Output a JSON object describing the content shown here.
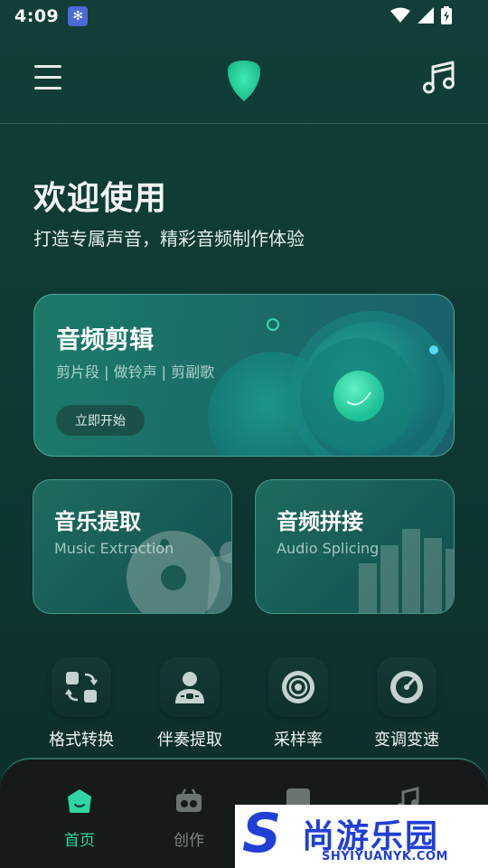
{
  "status_bar": {
    "time": "4:09"
  },
  "header": {
    "menu_icon": "hamburger-menu-icon",
    "logo_icon": "guitar-pick-logo",
    "right_icon": "music-note-icon"
  },
  "welcome": {
    "title": "欢迎使用",
    "subtitle": "打造专属声音，精彩音频制作体验"
  },
  "feature_cards": {
    "audio_edit": {
      "title": "音频剪辑",
      "tags": "剪片段 | 做铃声 | 剪副歌",
      "button": "立即开始"
    },
    "music_extract": {
      "title": "音乐提取",
      "subtitle": "Music Extraction"
    },
    "audio_splice": {
      "title": "音频拼接",
      "subtitle": "Audio Splicing"
    }
  },
  "tools": [
    {
      "label": "格式转换",
      "icon": "format-convert-icon"
    },
    {
      "label": "伴奏提取",
      "icon": "vocal-extract-icon"
    },
    {
      "label": "采样率",
      "icon": "sample-rate-icon"
    },
    {
      "label": "变调变速",
      "icon": "pitch-speed-icon"
    }
  ],
  "bottom_nav": [
    {
      "label": "首页",
      "icon": "home-icon",
      "active": true
    },
    {
      "label": "创作",
      "icon": "create-icon",
      "active": false
    }
  ],
  "watermark": {
    "logo_letter": "S",
    "name": "尚游乐园",
    "url": "SHYIYUANYK.COM"
  },
  "colors": {
    "accent": "#2fd6a4",
    "background": "#0f3a34",
    "nav_background": "#161a1a"
  }
}
